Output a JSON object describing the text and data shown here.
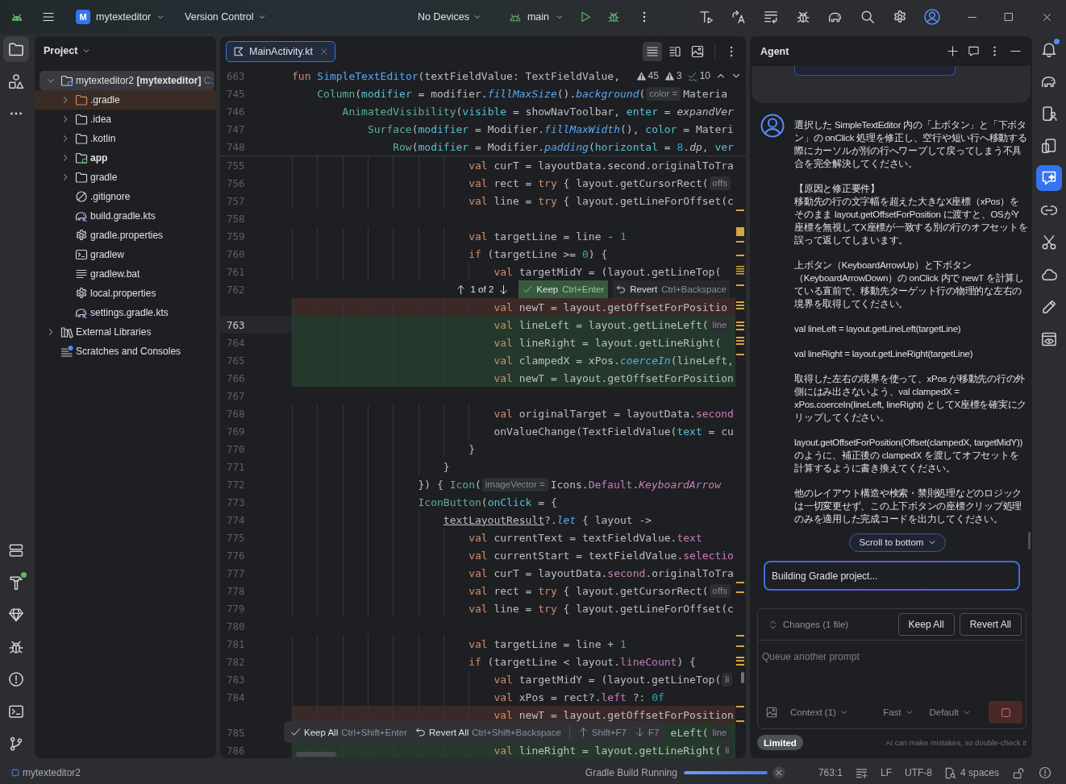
{
  "title_bar": {
    "project": {
      "initial": "M",
      "name": "mytexteditor"
    },
    "vcs": "Version Control",
    "device": "No Devices",
    "branch": "main"
  },
  "left_tool_windows": {
    "top": [
      {
        "kind": "project",
        "selected": true,
        "badge": false
      },
      {
        "kind": "structure",
        "selected": false,
        "badge": false
      }
    ],
    "bottom": [
      {
        "kind": "variants",
        "selected": false,
        "badge": false
      },
      {
        "kind": "build",
        "selected": false,
        "badge": true
      },
      {
        "kind": "gem",
        "selected": false,
        "badge": false
      },
      {
        "kind": "inspection",
        "selected": false,
        "badge": false
      },
      {
        "kind": "problems",
        "selected": false,
        "badge": false
      },
      {
        "kind": "terminal",
        "selected": false,
        "badge": false
      },
      {
        "kind": "git",
        "selected": false,
        "badge": false
      }
    ]
  },
  "right_tool_windows": {
    "top": [
      {
        "kind": "notifications",
        "selected": false,
        "badge": true
      },
      {
        "kind": "gradle",
        "selected": false,
        "badge": false
      },
      {
        "kind": "devices",
        "selected": false,
        "badge": false
      },
      {
        "kind": "mirroring",
        "selected": false,
        "badge": false
      },
      {
        "kind": "agent",
        "selected": true,
        "badge": false
      },
      {
        "kind": "links",
        "selected": false,
        "badge": false
      },
      {
        "kind": "tools",
        "selected": false,
        "badge": false
      },
      {
        "kind": "cloud",
        "selected": false,
        "badge": false
      },
      {
        "kind": "edit",
        "selected": false,
        "badge": false
      },
      {
        "kind": "preview",
        "selected": false,
        "badge": false
      }
    ]
  },
  "project_panel": {
    "title": "Project",
    "tree": [
      {
        "kind": "project",
        "name": "mytexteditor2",
        "module": "[mytexteditor]",
        "path": "C:",
        "expanded": true,
        "selected": true,
        "ignored": false,
        "children": [
          {
            "kind": "folder",
            "name": ".gradle",
            "expanded": false,
            "selected": false,
            "ignored": true
          },
          {
            "kind": "folder",
            "name": ".idea",
            "expanded": false,
            "selected": false,
            "ignored": false
          },
          {
            "kind": "folder",
            "name": ".kotlin",
            "expanded": false,
            "selected": false,
            "ignored": false
          },
          {
            "kind": "module",
            "name": "app",
            "expanded": false,
            "selected": false,
            "ignored": false
          },
          {
            "kind": "folder",
            "name": "gradle",
            "expanded": false,
            "selected": false,
            "ignored": false
          },
          {
            "kind": "gitignore",
            "name": ".gitignore",
            "selected": false,
            "ignored": false
          },
          {
            "kind": "script",
            "name": "build.gradle.kts",
            "selected": false,
            "ignored": false
          },
          {
            "kind": "properties",
            "name": "gradle.properties",
            "selected": false,
            "ignored": false
          },
          {
            "kind": "shell",
            "name": "gradlew",
            "selected": false,
            "ignored": false
          },
          {
            "kind": "text",
            "name": "gradlew.bat",
            "selected": false,
            "ignored": false
          },
          {
            "kind": "properties",
            "name": "local.properties",
            "selected": false,
            "ignored": false
          },
          {
            "kind": "script",
            "name": "settings.gradle.kts",
            "selected": false,
            "ignored": false
          }
        ]
      },
      {
        "kind": "libraries",
        "name": "External Libraries",
        "expanded": false,
        "selected": false,
        "ignored": false
      },
      {
        "kind": "scratches",
        "name": "Scratches and Consoles",
        "selected": false,
        "ignored": false
      }
    ]
  },
  "editor": {
    "tabs": [
      {
        "title": "MainActivity.kt",
        "selected": true
      }
    ],
    "view_modes": [
      {
        "kind": "code",
        "selected": true
      },
      {
        "kind": "split",
        "selected": false
      },
      {
        "kind": "design",
        "selected": false
      }
    ],
    "inspections": [
      {
        "kind": "warning",
        "count": "45"
      },
      {
        "kind": "weak",
        "count": "3"
      },
      {
        "kind": "typo",
        "count": "10"
      }
    ],
    "sticky_lines": [
      {
        "number": "663",
        "parts": [
          {
            "kind": "code",
            "tokens": [
              {
                "kind": "keyword",
                "text": "fun"
              },
              {
                "kind": "declaration",
                "text": " SimpleTextEditor"
              },
              {
                "kind": "plain",
                "text": "(textFieldValue: TextFieldValue,"
              }
            ]
          }
        ]
      },
      {
        "number": "745",
        "parts": [
          {
            "kind": "code",
            "tokens": [
              {
                "kind": "composable",
                "text": "    Column"
              },
              {
                "kind": "plain",
                "text": "("
              },
              {
                "kind": "argument",
                "text": "modifier"
              },
              {
                "kind": "plain",
                "text": " = modifier."
              },
              {
                "kind": "extension",
                "text": "fillMaxSize"
              },
              {
                "kind": "plain",
                "text": "()."
              },
              {
                "kind": "extension",
                "text": "background"
              },
              {
                "kind": "plain",
                "text": "("
              }
            ]
          },
          {
            "kind": "hint",
            "text": "color ="
          },
          {
            "kind": "code",
            "tokens": [
              {
                "kind": "plain",
                "text": "Materia"
              }
            ]
          }
        ]
      },
      {
        "number": "746",
        "parts": [
          {
            "kind": "code",
            "tokens": [
              {
                "kind": "composable",
                "text": "        AnimatedVisibility"
              },
              {
                "kind": "plain",
                "text": "("
              },
              {
                "kind": "argument",
                "text": "visible"
              },
              {
                "kind": "plain",
                "text": " = showNavToolbar, "
              },
              {
                "kind": "argument",
                "text": "enter"
              },
              {
                "kind": "plain",
                "text": " = "
              },
              {
                "kind": "call",
                "text": "expandVer"
              }
            ]
          }
        ]
      },
      {
        "number": "747",
        "parts": [
          {
            "kind": "code",
            "tokens": [
              {
                "kind": "composable",
                "text": "            Surface"
              },
              {
                "kind": "plain",
                "text": "("
              },
              {
                "kind": "argument",
                "text": "modifier"
              },
              {
                "kind": "plain",
                "text": " = Modifier."
              },
              {
                "kind": "extension",
                "text": "fillMaxWidth"
              },
              {
                "kind": "plain",
                "text": "(), "
              },
              {
                "kind": "argument",
                "text": "color"
              },
              {
                "kind": "plain",
                "text": " = Materi"
              }
            ]
          }
        ]
      },
      {
        "number": "748",
        "parts": [
          {
            "kind": "code",
            "tokens": [
              {
                "kind": "composable",
                "text": "                Row"
              },
              {
                "kind": "plain",
                "text": "("
              },
              {
                "kind": "argument",
                "text": "modifier"
              },
              {
                "kind": "plain",
                "text": " = Modifier."
              },
              {
                "kind": "extension",
                "text": "padding"
              },
              {
                "kind": "plain",
                "text": "("
              },
              {
                "kind": "argument",
                "text": "horizontal"
              },
              {
                "kind": "plain",
                "text": " = "
              },
              {
                "kind": "number",
                "text": "8"
              },
              {
                "kind": "plain",
                "text": "."
              },
              {
                "kind": "call",
                "text": "dp"
              },
              {
                "kind": "plain",
                "text": ", "
              },
              {
                "kind": "argument",
                "text": "ver"
              }
            ]
          }
        ]
      }
    ],
    "lines": [
      {
        "number": "755",
        "current": false,
        "kind": "context",
        "parts": [
          {
            "kind": "code",
            "tokens": [
              {
                "kind": "keyword",
                "text": "                            val"
              },
              {
                "kind": "plain",
                "text": " curT = layoutData.second.originalToTra"
              }
            ]
          }
        ]
      },
      {
        "number": "756",
        "current": false,
        "kind": "context",
        "parts": [
          {
            "kind": "code",
            "tokens": [
              {
                "kind": "keyword",
                "text": "                            val"
              },
              {
                "kind": "plain",
                "text": " rect = "
              },
              {
                "kind": "keyword",
                "text": "try"
              },
              {
                "kind": "plain",
                "text": " { layout.getCursorRect("
              }
            ]
          },
          {
            "kind": "hint",
            "text": "offs"
          }
        ]
      },
      {
        "number": "757",
        "current": false,
        "kind": "context",
        "parts": [
          {
            "kind": "code",
            "tokens": [
              {
                "kind": "keyword",
                "text": "                            val"
              },
              {
                "kind": "plain",
                "text": " line = "
              },
              {
                "kind": "keyword",
                "text": "try"
              },
              {
                "kind": "plain",
                "text": " { layout.getLineForOffset(c"
              }
            ]
          }
        ]
      },
      {
        "number": "758",
        "current": false,
        "kind": "context"
      },
      {
        "number": "759",
        "current": false,
        "kind": "context",
        "parts": [
          {
            "kind": "code",
            "tokens": [
              {
                "kind": "keyword",
                "text": "                            val"
              },
              {
                "kind": "plain",
                "text": " targetLine = line - "
              },
              {
                "kind": "number",
                "text": "1"
              }
            ]
          }
        ]
      },
      {
        "number": "760",
        "current": false,
        "kind": "context",
        "parts": [
          {
            "kind": "code",
            "tokens": [
              {
                "kind": "keyword",
                "text": "                            if"
              },
              {
                "kind": "plain",
                "text": " (targetLine >= "
              },
              {
                "kind": "number",
                "text": "0"
              },
              {
                "kind": "plain",
                "text": ") {"
              }
            ]
          }
        ]
      },
      {
        "number": "761",
        "current": false,
        "kind": "context",
        "parts": [
          {
            "kind": "code",
            "tokens": [
              {
                "kind": "keyword",
                "text": "                                val"
              },
              {
                "kind": "plain",
                "text": " targetMidY = (layout.getLineTop("
              }
            ]
          }
        ]
      },
      {
        "number": "762",
        "current": false,
        "kind": "context",
        "diff_navigator": {
          "position": "1 of 2",
          "keep_label": "Keep",
          "keep_shortcut": "Ctrl+Enter",
          "revert_label": "Revert",
          "revert_shortcut": "Ctrl+Backspace"
        }
      },
      {
        "kind": "deleted",
        "parts": [
          {
            "kind": "code",
            "tokens": [
              {
                "kind": "keyword",
                "text": "                                val"
              },
              {
                "kind": "plain",
                "text": " newT = layout.getOffsetForPositio"
              }
            ]
          }
        ]
      },
      {
        "number": "763",
        "current": true,
        "kind": "added",
        "parts": [
          {
            "kind": "code",
            "tokens": [
              {
                "kind": "keyword",
                "text": "                                val"
              },
              {
                "kind": "plain",
                "text": " lineLeft = layout.getLineLeft("
              }
            ]
          },
          {
            "kind": "hint",
            "text": "line"
          }
        ]
      },
      {
        "number": "764",
        "current": false,
        "kind": "added",
        "parts": [
          {
            "kind": "code",
            "tokens": [
              {
                "kind": "keyword",
                "text": "                                val"
              },
              {
                "kind": "plain",
                "text": " lineRight = layout.getLineRight("
              }
            ]
          }
        ]
      },
      {
        "number": "765",
        "current": false,
        "kind": "added",
        "parts": [
          {
            "kind": "code",
            "tokens": [
              {
                "kind": "keyword",
                "text": "                                val"
              },
              {
                "kind": "plain",
                "text": " clampedX = xPos."
              },
              {
                "kind": "extension",
                "text": "coerceIn"
              },
              {
                "kind": "plain",
                "text": "(lineLeft,"
              }
            ]
          }
        ]
      },
      {
        "number": "766",
        "current": false,
        "kind": "added",
        "parts": [
          {
            "kind": "code",
            "tokens": [
              {
                "kind": "keyword",
                "text": "                                val"
              },
              {
                "kind": "plain",
                "text": " newT = layout.getOffsetForPosition"
              }
            ]
          }
        ]
      },
      {
        "number": "767",
        "current": false,
        "kind": "context"
      },
      {
        "number": "768",
        "current": false,
        "kind": "context",
        "parts": [
          {
            "kind": "code",
            "tokens": [
              {
                "kind": "keyword",
                "text": "                                val"
              },
              {
                "kind": "plain",
                "text": " originalTarget = layoutData."
              },
              {
                "kind": "property",
                "text": "second"
              }
            ]
          }
        ]
      },
      {
        "number": "769",
        "current": false,
        "kind": "context",
        "parts": [
          {
            "kind": "code",
            "tokens": [
              {
                "kind": "plain",
                "text": "                                onValueChange(TextFieldValue("
              },
              {
                "kind": "argument",
                "text": "text"
              },
              {
                "kind": "plain",
                "text": " = cu"
              }
            ]
          }
        ]
      },
      {
        "number": "770",
        "current": false,
        "kind": "context",
        "parts": [
          {
            "kind": "code",
            "tokens": [
              {
                "kind": "plain",
                "text": "                            }"
              }
            ]
          }
        ]
      },
      {
        "number": "771",
        "current": false,
        "kind": "context",
        "parts": [
          {
            "kind": "code",
            "tokens": [
              {
                "kind": "plain",
                "text": "                        }"
              }
            ]
          }
        ]
      },
      {
        "number": "772",
        "current": false,
        "kind": "context",
        "parts": [
          {
            "kind": "code",
            "tokens": [
              {
                "kind": "plain",
                "text": "                    }) { "
              },
              {
                "kind": "composable",
                "text": "Icon"
              },
              {
                "kind": "plain",
                "text": "("
              }
            ]
          },
          {
            "kind": "hint",
            "text": "imageVector ="
          },
          {
            "kind": "code",
            "tokens": [
              {
                "kind": "plain",
                "text": "Icons."
              },
              {
                "kind": "property",
                "text": "Default"
              },
              {
                "kind": "plain",
                "text": "."
              },
              {
                "kind": "constant",
                "text": "KeyboardArrow"
              }
            ]
          }
        ]
      },
      {
        "number": "773",
        "current": false,
        "kind": "context",
        "parts": [
          {
            "kind": "code",
            "tokens": [
              {
                "kind": "composable",
                "text": "                    IconButton"
              },
              {
                "kind": "plain",
                "text": "("
              },
              {
                "kind": "argument",
                "text": "onClick"
              },
              {
                "kind": "plain",
                "text": " = {"
              }
            ]
          }
        ]
      },
      {
        "number": "774",
        "current": false,
        "kind": "context",
        "parts": [
          {
            "kind": "code",
            "tokens": [
              {
                "kind": "reference",
                "text": "                        textLayoutResult"
              },
              {
                "kind": "plain",
                "text": "?."
              },
              {
                "kind": "extension",
                "text": "let"
              },
              {
                "kind": "plain",
                "text": " { layout ->"
              }
            ]
          }
        ]
      },
      {
        "number": "775",
        "current": false,
        "kind": "context",
        "parts": [
          {
            "kind": "code",
            "tokens": [
              {
                "kind": "keyword",
                "text": "                            val"
              },
              {
                "kind": "plain",
                "text": " currentText = textFieldValue."
              },
              {
                "kind": "property",
                "text": "text"
              }
            ]
          }
        ]
      },
      {
        "number": "776",
        "current": false,
        "kind": "context",
        "parts": [
          {
            "kind": "code",
            "tokens": [
              {
                "kind": "keyword",
                "text": "                            val"
              },
              {
                "kind": "plain",
                "text": " currentStart = textFieldValue."
              },
              {
                "kind": "property",
                "text": "selectio"
              }
            ]
          }
        ]
      },
      {
        "number": "777",
        "current": false,
        "kind": "context",
        "parts": [
          {
            "kind": "code",
            "tokens": [
              {
                "kind": "keyword",
                "text": "                            val"
              },
              {
                "kind": "plain",
                "text": " curT = layoutData."
              },
              {
                "kind": "property",
                "text": "second"
              },
              {
                "kind": "plain",
                "text": ".originalToTra"
              }
            ]
          }
        ]
      },
      {
        "number": "778",
        "current": false,
        "kind": "context",
        "parts": [
          {
            "kind": "code",
            "tokens": [
              {
                "kind": "keyword",
                "text": "                            val"
              },
              {
                "kind": "plain",
                "text": " rect = "
              },
              {
                "kind": "keyword",
                "text": "try"
              },
              {
                "kind": "plain",
                "text": " { layout.getCursorRect("
              }
            ]
          },
          {
            "kind": "hint",
            "text": "offs"
          }
        ]
      },
      {
        "number": "779",
        "current": false,
        "kind": "context",
        "parts": [
          {
            "kind": "code",
            "tokens": [
              {
                "kind": "keyword",
                "text": "                            val"
              },
              {
                "kind": "plain",
                "text": " line = "
              },
              {
                "kind": "keyword",
                "text": "try"
              },
              {
                "kind": "plain",
                "text": " { layout.getLineForOffset(c"
              }
            ]
          }
        ]
      },
      {
        "number": "780",
        "current": false,
        "kind": "context"
      },
      {
        "number": "781",
        "current": false,
        "kind": "context",
        "parts": [
          {
            "kind": "code",
            "tokens": [
              {
                "kind": "keyword",
                "text": "                            val"
              },
              {
                "kind": "plain",
                "text": " targetLine = line + "
              },
              {
                "kind": "number",
                "text": "1"
              }
            ]
          }
        ]
      },
      {
        "number": "782",
        "current": false,
        "kind": "context",
        "parts": [
          {
            "kind": "code",
            "tokens": [
              {
                "kind": "keyword",
                "text": "                            if"
              },
              {
                "kind": "plain",
                "text": " (targetLine < layout."
              },
              {
                "kind": "property",
                "text": "lineCount"
              },
              {
                "kind": "plain",
                "text": ") {"
              }
            ]
          }
        ]
      },
      {
        "number": "783",
        "current": false,
        "kind": "context",
        "parts": [
          {
            "kind": "code",
            "tokens": [
              {
                "kind": "keyword",
                "text": "                                val"
              },
              {
                "kind": "plain",
                "text": " targetMidY = (layout.getLineTop("
              }
            ]
          },
          {
            "kind": "hint",
            "text": "li"
          }
        ]
      },
      {
        "number": "784",
        "current": false,
        "kind": "context",
        "parts": [
          {
            "kind": "code",
            "tokens": [
              {
                "kind": "keyword",
                "text": "                                val"
              },
              {
                "kind": "plain",
                "text": " xPos = rect?."
              },
              {
                "kind": "property",
                "text": "left"
              },
              {
                "kind": "plain",
                "text": " ?: "
              },
              {
                "kind": "number",
                "text": "0f"
              }
            ]
          }
        ]
      },
      {
        "kind": "deleted",
        "parts": [
          {
            "kind": "code",
            "tokens": [
              {
                "kind": "keyword",
                "text": "                                val"
              },
              {
                "kind": "plain",
                "text": " newT = layout.getOffsetForPosition"
              }
            ]
          }
        ]
      },
      {
        "number": "785",
        "current": false,
        "kind": "added",
        "parts": [
          {
            "kind": "code",
            "tokens": [
              {
                "kind": "plain",
                "text": "                                                            eLeft("
              }
            ]
          },
          {
            "kind": "hint",
            "text": "line"
          }
        ]
      },
      {
        "number": "786",
        "current": false,
        "kind": "added",
        "parts": [
          {
            "kind": "code",
            "tokens": [
              {
                "kind": "keyword",
                "text": "                                val"
              },
              {
                "kind": "plain",
                "text": " lineRight = layout.getLineRight("
              }
            ]
          },
          {
            "kind": "hint",
            "text": "li"
          }
        ]
      }
    ],
    "diff_toolbar": {
      "keep_all_label": "Keep All",
      "keep_all_shortcut": "Ctrl+Shift+Enter",
      "revert_all_label": "Revert All",
      "revert_all_shortcut": "Ctrl+Shift+Backspace",
      "previous_shortcut": "Shift+F7",
      "next_shortcut": "F7"
    }
  },
  "agent": {
    "title": "Agent",
    "message": [
      [
        "選択した SimpleTextEditor 内の「上ボタン」と「下ボタン」の onClick 処理を修正し、空行や短い行へ移動する際にカーソルが別の行へワープして戻ってしまう不具合を完全解決してください。"
      ],
      [
        "【原因と修正要件】",
        "移動先の行の文字幅を超えた大きなX座標（xPos）をそのまま layout.getOffsetForPosition に渡すと、OSがY座標を無視してX座標が一致する別の行のオフセットを誤って返してしまいます。"
      ],
      [
        "上ボタン（KeyboardArrowUp）と下ボタン（KeyboardArrowDown）の onClick 内で newT を計算している直前で、移動先ターゲット行の物理的な左右の境界を取得してください。"
      ],
      [
        "val lineLeft = layout.getLineLeft(targetLine)"
      ],
      [
        "val lineRight = layout.getLineRight(targetLine)"
      ],
      [
        "取得した左右の境界を使って、xPos が移動先の行の外側にはみ出さないよう、val clampedX = xPos.coerceIn(lineLeft, lineRight) としてX座標を確実にクリップしてください。"
      ],
      [
        "layout.getOffsetForPosition(Offset(clampedX, targetMidY)) のように、補正後の clampedX を渡してオフセットを計算するように書き換えてください。"
      ],
      [
        "他のレイアウト構造や検索・禁則処理などのロジックは一切変更せず、この上下ボタンの座標クリップ処理のみを適用した完成コードを出力してください。"
      ]
    ],
    "scroll_button": "Scroll to bottom",
    "status": "Building Gradle project...",
    "changes": {
      "summary": "Changes (1 file)",
      "keep_all": "Keep All",
      "revert_all": "Revert All"
    },
    "prompt": {
      "placeholder": "Queue another prompt",
      "context": "Context (1)",
      "speed": "Fast",
      "model": "Default"
    },
    "plan": "Limited",
    "disclaimer": "AI can make mistakes, so double-check it"
  },
  "status_bar": {
    "project": "mytexteditor2",
    "task": "Gradle Build Running",
    "progress": {
      "level": 1
    },
    "caret": "763:1",
    "line_separator": "LF",
    "encoding": "UTF-8",
    "indent": "4 spaces"
  }
}
